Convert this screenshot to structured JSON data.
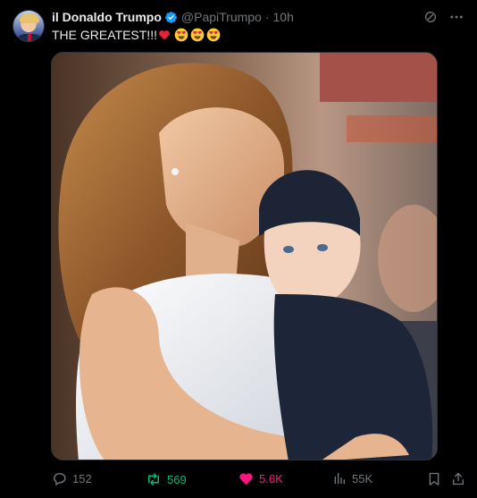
{
  "tweet": {
    "author_name": "il Donaldo Trumpo",
    "handle": "@PapiTrumpo",
    "separator": "·",
    "time": "10h",
    "text": "THE GREATEST!!!"
  },
  "emojis": [
    "red-heart",
    "heart-eyes",
    "heart-eyes",
    "heart-eyes"
  ],
  "actions": {
    "replies": "152",
    "reposts": "569",
    "likes": "5.6K",
    "views": "55K"
  },
  "colors": {
    "background": "#000000",
    "text": "#e7e9ea",
    "muted": "#71767b",
    "verified": "#1d9bf0",
    "repost_active": "#00ba7c",
    "like_active": "#f91880"
  }
}
